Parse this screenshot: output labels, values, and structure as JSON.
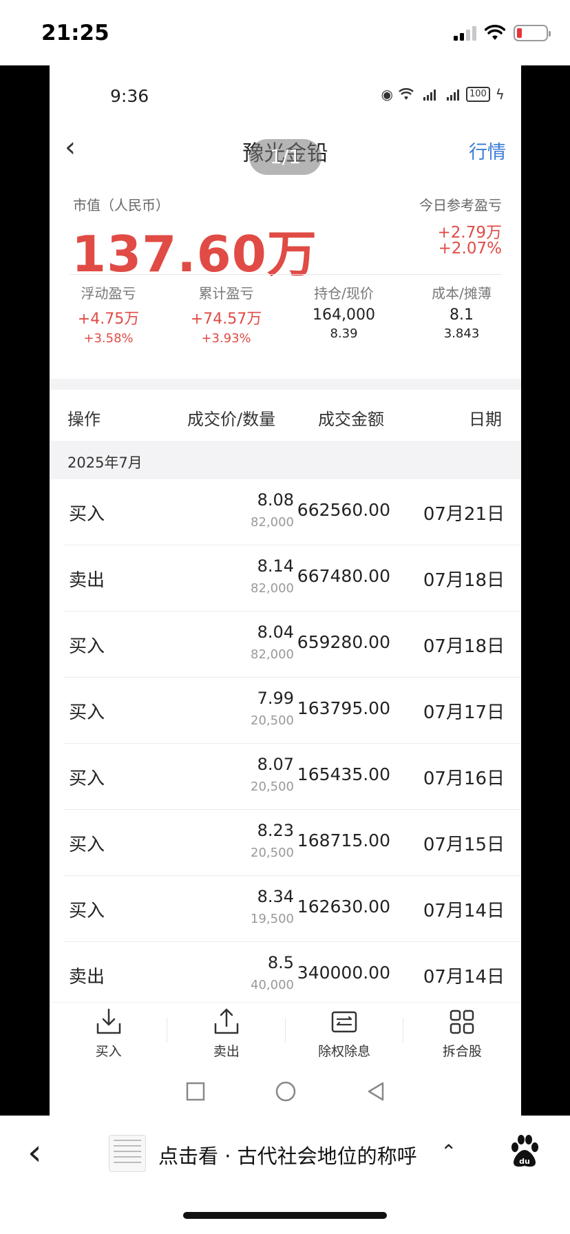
{
  "ios_status": {
    "time": "21:25"
  },
  "android_status": {
    "time": "9:36",
    "battery": "100"
  },
  "nav": {
    "back_icon": "chevron-left-icon",
    "title": "豫光金铅",
    "right_link": "行情",
    "page_indicator": "1/1"
  },
  "summary": {
    "market_value_label": "市值（人民币）",
    "market_value": "137.60万",
    "today_label": "今日参考盈亏",
    "today_amount": "+2.79万",
    "today_pct": "+2.07%",
    "stats": [
      {
        "label": "浮动盈亏",
        "v1": "+4.75万",
        "v2": "+3.58%",
        "color": "red"
      },
      {
        "label": "累计盈亏",
        "v1": "+74.57万",
        "v2": "+3.93%",
        "color": "red"
      },
      {
        "label": "持仓/现价",
        "v1": "164,000",
        "v2": "8.39",
        "color": "dark"
      },
      {
        "label": "成本/摊薄",
        "v1": "8.1",
        "v2": "3.843",
        "color": "dark"
      }
    ]
  },
  "table": {
    "headers": {
      "op": "操作",
      "price_qty": "成交价/数量",
      "amount": "成交金额",
      "date": "日期"
    },
    "month": "2025年7月",
    "rows": [
      {
        "op": "买入",
        "price": "8.08",
        "qty": "82,000",
        "amount": "662560.00",
        "date": "07月21日"
      },
      {
        "op": "卖出",
        "price": "8.14",
        "qty": "82,000",
        "amount": "667480.00",
        "date": "07月18日"
      },
      {
        "op": "买入",
        "price": "8.04",
        "qty": "82,000",
        "amount": "659280.00",
        "date": "07月18日"
      },
      {
        "op": "买入",
        "price": "7.99",
        "qty": "20,500",
        "amount": "163795.00",
        "date": "07月17日"
      },
      {
        "op": "买入",
        "price": "8.07",
        "qty": "20,500",
        "amount": "165435.00",
        "date": "07月16日"
      },
      {
        "op": "买入",
        "price": "8.23",
        "qty": "20,500",
        "amount": "168715.00",
        "date": "07月15日"
      },
      {
        "op": "买入",
        "price": "8.34",
        "qty": "19,500",
        "amount": "162630.00",
        "date": "07月14日"
      },
      {
        "op": "卖出",
        "price": "8.5",
        "qty": "40,000",
        "amount": "340000.00",
        "date": "07月14日"
      }
    ]
  },
  "toolbar": [
    {
      "label": "买入",
      "icon": "buy-download-icon"
    },
    {
      "label": "卖出",
      "icon": "sell-upload-icon"
    },
    {
      "label": "除权除息",
      "icon": "ex-dividend-icon"
    },
    {
      "label": "拆合股",
      "icon": "split-merge-grid-icon"
    }
  ],
  "browser_bar": {
    "text": "点击看 · 古代社会地位的称呼",
    "caret": "⌃"
  },
  "colors": {
    "red": "#e04b45",
    "blue": "#3a7bd5"
  }
}
